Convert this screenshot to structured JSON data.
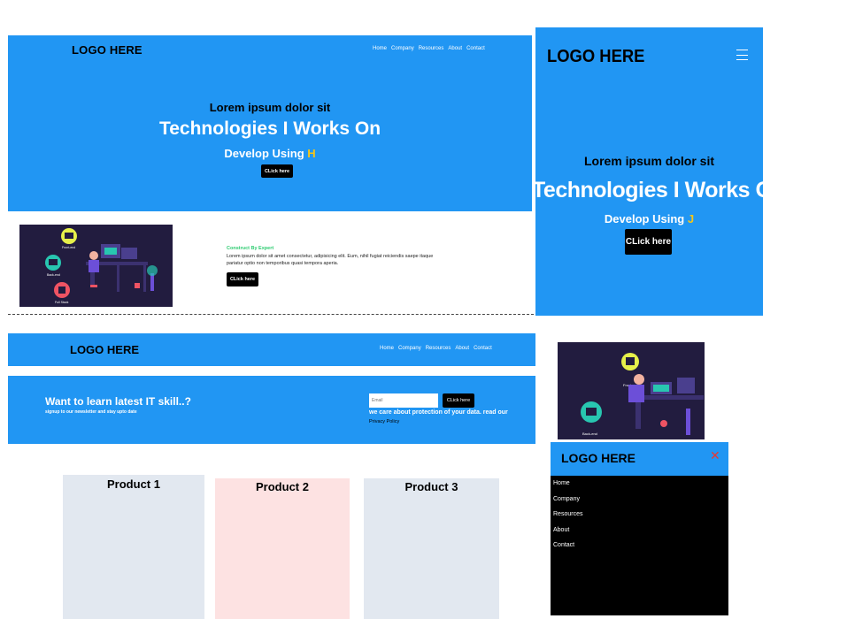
{
  "hero": {
    "logo": "LOGO HERE",
    "nav": [
      "Home",
      "Company",
      "Resources",
      "About",
      "Contact"
    ],
    "subtitle": "Lorem ipsum dolor sit",
    "title": "Technologies I Works On",
    "develop": "Develop Using ",
    "develop_letter": "H",
    "button": "CLick here"
  },
  "construct": {
    "title": "Construct By Expert",
    "text": "Lorem ipsum dolor sit amet consectetur, adipisicing elit. Eum, nihil fugiat reiciendis saepe itaque pariatur optio non temporibus quasi tempora aperia.",
    "button": "CLick here",
    "illustration_labels": [
      "Front-end",
      "Back-end",
      "Full Stack"
    ]
  },
  "mobile_hero": {
    "logo": "LOGO HERE",
    "menu_icon": "hamburger-icon",
    "subtitle": "Lorem ipsum dolor sit",
    "title": "Technologies I Works On",
    "develop": "Develop Using ",
    "develop_letter": "J",
    "button": "CLick here"
  },
  "navbar2": {
    "logo": "LOGO HERE",
    "nav": [
      "Home",
      "Company",
      "Resources",
      "About",
      "Contact"
    ]
  },
  "newsletter": {
    "heading": "Want to learn latest IT skill..?",
    "subheading": "signup to our newsletter and stay upto date",
    "email_placeholder": "Email",
    "button": "CLick here",
    "notice": "we care about protection of your data. read our",
    "privacy_link": "Privacy Policy"
  },
  "products": [
    "Product 1",
    "Product 2",
    "Product 3"
  ],
  "mobile_menu": {
    "logo": "LOGO HERE",
    "close_icon": "close-icon",
    "items": [
      "Home",
      "Company",
      "Resources",
      "About",
      "Contact"
    ]
  },
  "colors": {
    "primary": "#2196f3",
    "accent": "#f5c518",
    "construct_title": "#2ecc71",
    "close": "#e53935"
  }
}
